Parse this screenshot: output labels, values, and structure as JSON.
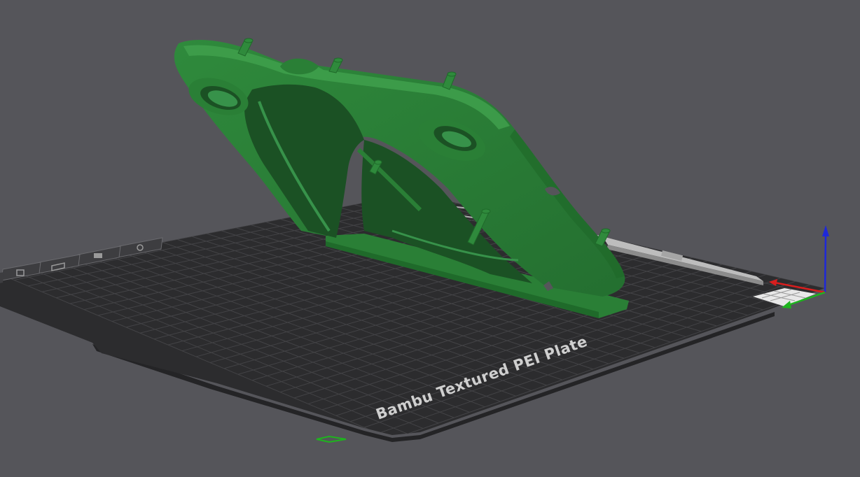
{
  "viewport": {
    "background": "#55555a",
    "plate": {
      "label": "Bambu Textured PEI Plate",
      "surface_color": "#2c2c2e",
      "grid_color": "#434346",
      "label_color": "#cfcfcf"
    },
    "model": {
      "color": "#2f8a3c",
      "shadow_color": "#1e5a26",
      "highlight_color": "#3fa04c"
    },
    "axes": {
      "x_color": "#d81e1e",
      "y_color": "#1eb41e",
      "z_color": "#1e28d8"
    },
    "plate_icons": [
      "plate-settings-icon",
      "plate-lock-icon",
      "plate-arrange-icon",
      "plate-orient-icon",
      "plate-slice-icon"
    ]
  }
}
